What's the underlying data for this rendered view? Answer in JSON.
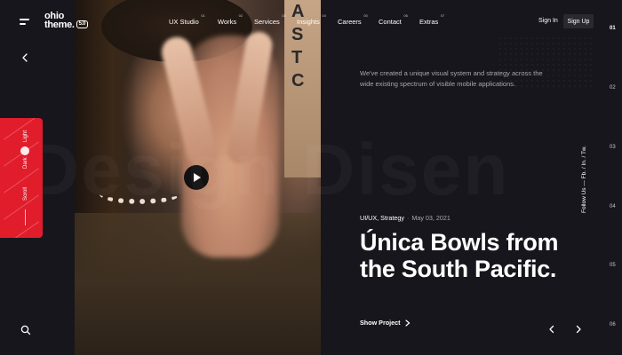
{
  "brand": {
    "line1": "ohio",
    "line2": "theme.",
    "badge": "5.0"
  },
  "nav": {
    "items": [
      {
        "label": "UX Studio",
        "num": "01"
      },
      {
        "label": "Works",
        "num": "02"
      },
      {
        "label": "Services",
        "num": "03"
      },
      {
        "label": "Insights",
        "num": "04"
      },
      {
        "label": "Careers",
        "num": "05"
      },
      {
        "label": "Contact",
        "num": "06"
      },
      {
        "label": "Extras",
        "num": "07"
      }
    ]
  },
  "auth": {
    "signin": "Sign In",
    "signup": "Sign Up"
  },
  "theme_switch": {
    "light": "Light",
    "dark": "Dark",
    "scroll": "Scroll",
    "accent": "#e11d2b"
  },
  "watermark": "Design Disen",
  "photo": {
    "sign_letters": [
      "A",
      "S",
      "T",
      "C"
    ]
  },
  "hero": {
    "intro": "We've created a unique visual system and strategy across the wide existing spectrum of visible mobile applications.",
    "category": "UI/UX, Strategy",
    "date": "May 03, 2021",
    "title": "Única Bowls from the South Pacific.",
    "cta": "Show Project"
  },
  "follow": {
    "label": "Follow Us —",
    "links": [
      "Fb.",
      "In.",
      "Tw."
    ]
  },
  "pager": [
    "01",
    "02",
    "03",
    "04",
    "05",
    "06"
  ],
  "icons": {
    "menu": "menu-icon",
    "back": "chevron-left-icon",
    "search": "search-icon",
    "play": "play-icon",
    "prev": "chevron-left-icon",
    "next": "chevron-right-icon"
  },
  "colors": {
    "background": "#17161c",
    "text": "#ffffff",
    "muted": "#a8a7b0"
  }
}
